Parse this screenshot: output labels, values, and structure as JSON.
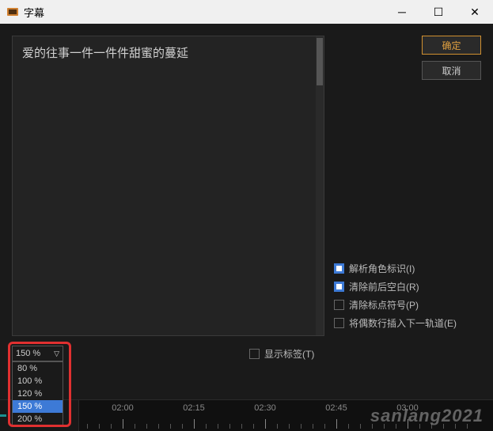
{
  "window": {
    "title": "字幕"
  },
  "subtitle_text": "爱的往事一件一件件甜蜜的蔓延",
  "buttons": {
    "ok": "确定",
    "cancel": "取消"
  },
  "options": {
    "parse_role": {
      "label": "解析角色标识(I)",
      "checked": true
    },
    "trim_spaces": {
      "label": "清除前后空白(R)",
      "checked": true
    },
    "clear_punct": {
      "label": "清除标点符号(P)",
      "checked": false
    },
    "even_next_track": {
      "label": "将偶数行插入下一轨道(E)",
      "checked": false
    }
  },
  "zoom": {
    "current": "150 %",
    "items": [
      "80 %",
      "100 %",
      "120 %",
      "150 %",
      "200 %"
    ],
    "selected_index": 3
  },
  "show_label": "显示标签(T)",
  "timeline": {
    "labels": [
      "02:00",
      "02:15",
      "02:30",
      "02:45",
      "03:00"
    ]
  },
  "watermark": "sanlang2021"
}
